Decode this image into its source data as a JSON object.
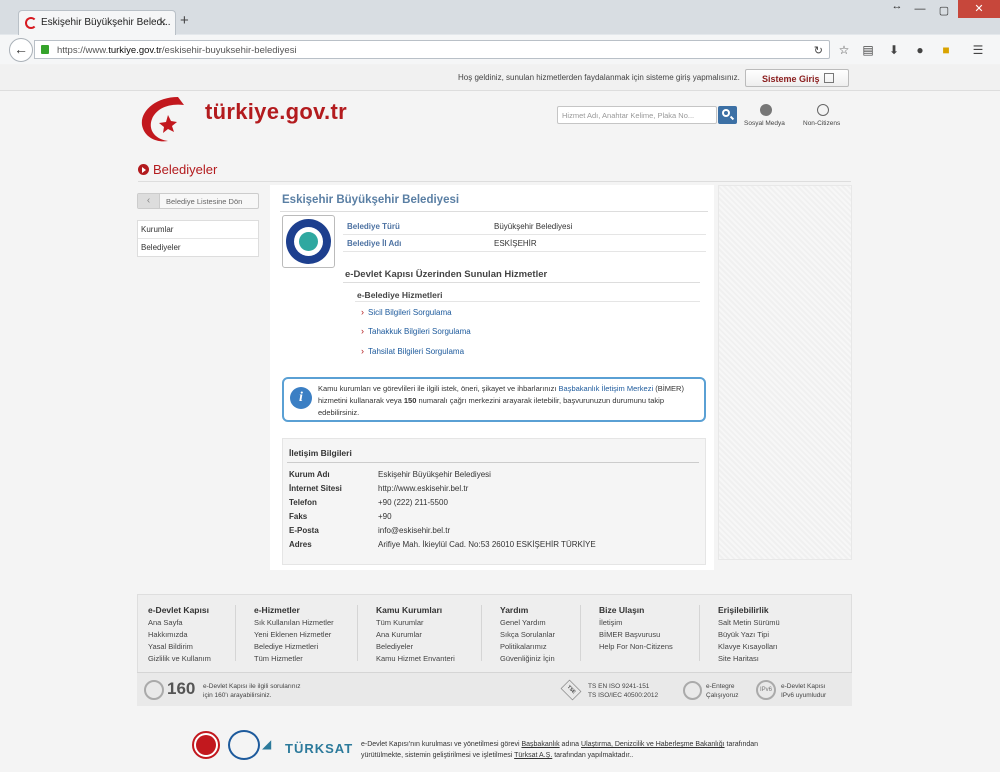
{
  "browser": {
    "tab_title": "Eskişehir Büyükşehir Beled...",
    "url_prefix": "https://www.",
    "url_domain": "turkiye.gov.tr",
    "url_path": "/eskisehir-buyuksehir-belediyesi"
  },
  "topbar": {
    "welcome": "Hoş geldiniz, sunulan hizmetlerden faydalanmak için sisteme giriş yapmalısınız.",
    "login_label": "Sisteme Giriş"
  },
  "header": {
    "logo_text": "türkiye.gov.tr",
    "search_placeholder": "Hizmet Adı, Anahtar Kelime, Plaka No...",
    "social_label": "Sosyal Medya",
    "noncitizens_label": "Non-Citizens"
  },
  "section_title": "Belediyeler",
  "sidebar": {
    "back_label": "Belediye Listesine Dön",
    "items": [
      "Kurumlar",
      "Belediyeler"
    ]
  },
  "main": {
    "title": "Eskişehir Büyükşehir Belediyesi",
    "info": [
      {
        "key": "Belediye Türü",
        "value": "Büyükşehir Belediyesi"
      },
      {
        "key": "Belediye İl Adı",
        "value": "ESKİŞEHİR"
      }
    ],
    "services_title": "e-Devlet Kapısı Üzerinden Sunulan Hizmetler",
    "services_group": "e-Belediye Hizmetleri",
    "services": [
      "Sicil Bilgileri Sorgulama",
      "Tahakkuk Bilgileri Sorgulama",
      "Tahsilat Bilgileri Sorgulama"
    ],
    "notice": {
      "part1": "Kamu kurumları ve görevlileri ile ilgili istek, öneri, şikayet ve ihbarlarınızı ",
      "link": "Başbakanlık İletişim Merkezi",
      "part2": " (BİMER) hizmetini kullanarak veya ",
      "bold": "150",
      "part3": " numaralı çağrı merkezini arayarak iletebilir, başvurunuzun durumunu takip edebilirsiniz."
    },
    "contact": {
      "title": "İletişim Bilgileri",
      "rows": [
        {
          "key": "Kurum Adı",
          "value": "Eskişehir Büyükşehir Belediyesi"
        },
        {
          "key": "İnternet Sitesi",
          "value": "http://www.eskisehir.bel.tr"
        },
        {
          "key": "Telefon",
          "value": "+90 (222) 211-5500"
        },
        {
          "key": "Faks",
          "value": "+90"
        },
        {
          "key": "E-Posta",
          "value": "info@eskisehir.bel.tr"
        },
        {
          "key": "Adres",
          "value": "Arifiye Mah. İkieylül Cad. No:53 26010 ESKİŞEHİR TÜRKİYE"
        }
      ]
    }
  },
  "footer": {
    "columns": [
      {
        "title": "e-Devlet Kapısı",
        "items": [
          "Ana Sayfa",
          "Hakkımızda",
          "Yasal Bildirim",
          "Gizlilik ve Kullanım"
        ]
      },
      {
        "title": "e-Hizmetler",
        "items": [
          "Sık Kullanılan Hizmetler",
          "Yeni Eklenen Hizmetler",
          "Belediye Hizmetleri",
          "Tüm Hizmetler"
        ]
      },
      {
        "title": "Kamu Kurumları",
        "items": [
          "Tüm Kurumlar",
          "Ana Kurumlar",
          "Belediyeler",
          "Kamu Hizmet Envanteri"
        ]
      },
      {
        "title": "Yardım",
        "items": [
          "Genel Yardım",
          "Sıkça Sorulanlar",
          "Politikalarımız",
          "Güvenliğiniz İçin"
        ]
      },
      {
        "title": "Bize Ulaşın",
        "items": [
          "İletişim",
          "BİMER Başvurusu",
          "Help For Non-Citizens"
        ]
      },
      {
        "title": "Erişilebilirlik",
        "items": [
          "Salt Metin Sürümü",
          "Büyük Yazı Tipi",
          "Klavye Kısayolları",
          "Site Haritası"
        ]
      }
    ],
    "callcenter_number": "160",
    "callcenter_text1": "e-Devlet Kapısı ile ilgili sorularınız",
    "callcenter_text2": "için 160'ı arayabilirsiniz.",
    "iso_badge": "TSE",
    "iso1": "TS EN ISO 9241-151",
    "iso2": "TS ISO/IEC 40500:2012",
    "eentegre1": "e-Entegre",
    "eentegre2": "Çalışıyoruz",
    "ipv6_badge": "IPv6",
    "ipv6_1": "e-Devlet Kapısı",
    "ipv6_2": "IPv6 uyumludur"
  },
  "credits": {
    "turksat": "TÜRKSAT",
    "line1_a": "e-Devlet Kapısı'nın kurulması ve yönetilmesi görevi ",
    "line1_link1": "Başbakanlık",
    "line1_b": " adına ",
    "line1_link2": "Ulaştırma, Denizcilik ve Haberleşme Bakanlığı",
    "line1_c": " tarafından",
    "line2_a": "yürütülmekte, sistemin geliştirilmesi ve işletilmesi ",
    "line2_link": "Türksat A.Ş.",
    "line2_b": " tarafından yapılmaktadır.."
  }
}
